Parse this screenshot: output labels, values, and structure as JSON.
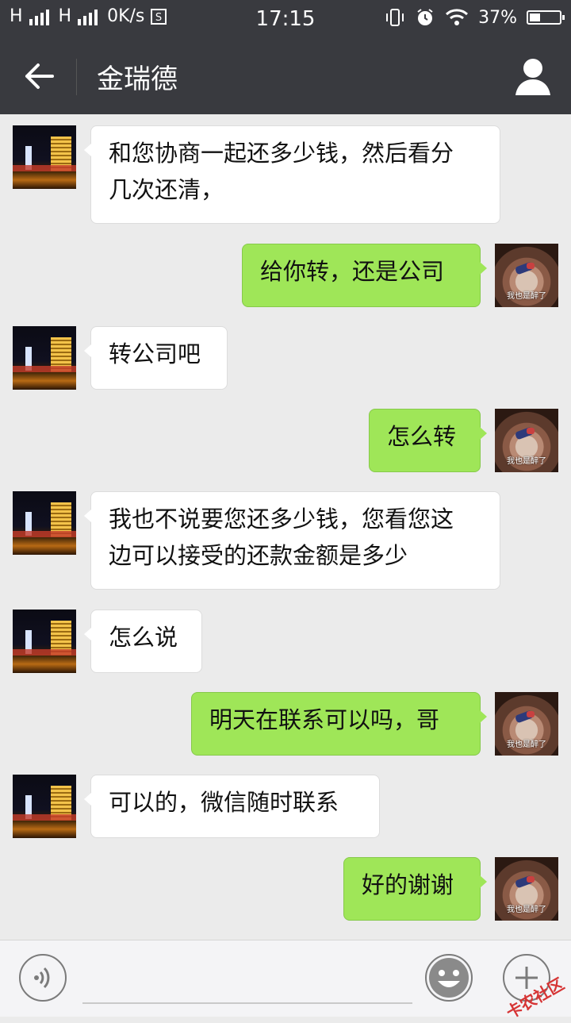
{
  "status_bar": {
    "signal1": "H",
    "signal2": "H",
    "network_speed": "0K/s",
    "time": "17:15",
    "battery_percent": "37%",
    "battery_level": 0.37
  },
  "header": {
    "title": "金瑞德",
    "back_icon": "arrow-left-icon",
    "profile_icon": "person-icon"
  },
  "messages": [
    {
      "side": "left",
      "text_line1": "和您协商一起还多少钱，然后看分",
      "text_line2": "几次还清，"
    },
    {
      "side": "right",
      "text": "给你转，还是公司"
    },
    {
      "side": "left",
      "text": "转公司吧"
    },
    {
      "side": "right",
      "text": "怎么转"
    },
    {
      "side": "left",
      "text_line1": "我也不说要您还多少钱，您看您这",
      "text_line2": "边可以接受的还款金额是多少"
    },
    {
      "side": "left",
      "text": "怎么说"
    },
    {
      "side": "right",
      "text": "明天在联系可以吗，哥"
    },
    {
      "side": "left",
      "text": "可以的，微信随时联系"
    },
    {
      "side": "right",
      "text": "好的谢谢"
    }
  ],
  "self_avatar_caption": "我也是醉了",
  "input_bar": {
    "voice_icon": "voice-icon",
    "emoji_icon": "emoji-icon",
    "add_icon": "plus-icon"
  },
  "watermark": "卡农社区",
  "colors": {
    "header_bg": "#393a3f",
    "chat_bg": "#ebebeb",
    "sent_bubble": "#9fe658",
    "received_bubble": "#ffffff"
  }
}
